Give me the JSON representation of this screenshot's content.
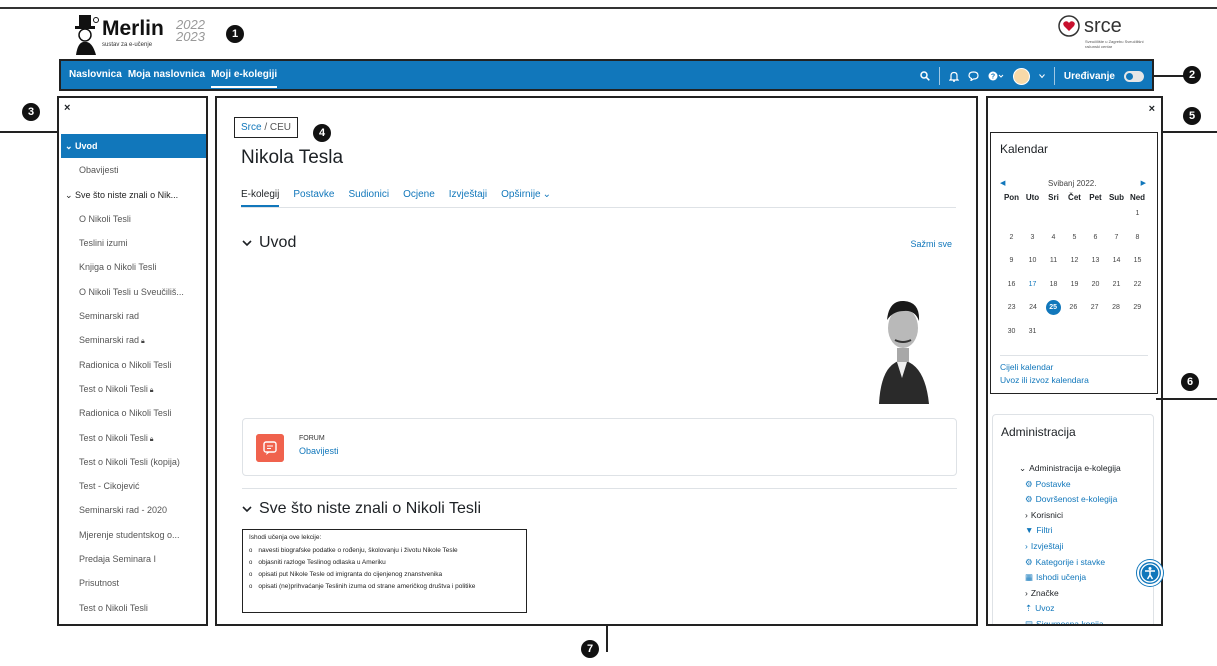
{
  "header": {
    "logo_text": "Merlin",
    "logo_sub": "sustav za e-učenje",
    "logo_year": "2022 2023",
    "partner_logo": "srce",
    "partner_sub": "Sveučilište u Zagrebu Sveučilišni računski centar"
  },
  "callouts": [
    "1",
    "2",
    "3",
    "4",
    "5",
    "6",
    "7"
  ],
  "navbar": {
    "links": [
      "Naslovnica",
      "Moja naslovnica",
      "Moji e-kolegiji"
    ],
    "active_index": 2,
    "icons": [
      "search-icon",
      "bell-icon",
      "chat-icon",
      "help-icon",
      "avatar-icon"
    ],
    "edit_label": "Uređivanje",
    "edit_on": false
  },
  "drawer": {
    "close": "×",
    "items": [
      {
        "label": "Uvod",
        "kind": "section",
        "active": true,
        "locked": false
      },
      {
        "label": "Obavijesti",
        "kind": "item",
        "active": false,
        "locked": false
      },
      {
        "label": "Sve što niste znali o Nik...",
        "kind": "section",
        "active": false,
        "locked": false
      },
      {
        "label": "O Nikoli Tesli",
        "kind": "item",
        "active": false,
        "locked": false
      },
      {
        "label": "Teslini izumi",
        "kind": "item",
        "active": false,
        "locked": false
      },
      {
        "label": "Knjiga o Nikoli Tesli",
        "kind": "item",
        "active": false,
        "locked": false
      },
      {
        "label": "O Nikoli Tesli u Sveučiliš...",
        "kind": "item",
        "active": false,
        "locked": false
      },
      {
        "label": "Seminarski rad",
        "kind": "item",
        "active": false,
        "locked": false
      },
      {
        "label": "Seminarski rad",
        "kind": "item",
        "active": false,
        "locked": true
      },
      {
        "label": "Radionica o Nikoli Tesli",
        "kind": "item",
        "active": false,
        "locked": false
      },
      {
        "label": "Test o Nikoli Tesli",
        "kind": "item",
        "active": false,
        "locked": true
      },
      {
        "label": "Radionica o Nikoli Tesli",
        "kind": "item",
        "active": false,
        "locked": false
      },
      {
        "label": "Test o Nikoli Tesli",
        "kind": "item",
        "active": false,
        "locked": true
      },
      {
        "label": "Test o Nikoli Tesli (kopija)",
        "kind": "item",
        "active": false,
        "locked": false
      },
      {
        "label": "Test - Cikojević",
        "kind": "item",
        "active": false,
        "locked": false
      },
      {
        "label": "Seminarski rad - 2020",
        "kind": "item",
        "active": false,
        "locked": false
      },
      {
        "label": "Mjerenje studentskog o...",
        "kind": "item",
        "active": false,
        "locked": false
      },
      {
        "label": "Predaja Seminara I",
        "kind": "item",
        "active": false,
        "locked": false
      },
      {
        "label": "Prisutnost",
        "kind": "item",
        "active": false,
        "locked": false
      },
      {
        "label": "Test o Nikoli Tesli",
        "kind": "item",
        "active": false,
        "locked": false
      }
    ]
  },
  "main": {
    "breadcrumb": {
      "link": "Srce",
      "sep": "/",
      "current": "CEU"
    },
    "title": "Nikola Tesla",
    "tabs": [
      "E-kolegij",
      "Postavke",
      "Sudionici",
      "Ocjene",
      "Izvještaji",
      "Opširnije"
    ],
    "active_tab": 0,
    "section1": {
      "title": "Uvod",
      "collapse_all": "Sažmi sve"
    },
    "forum": {
      "type": "FORUM",
      "name": "Obavijesti"
    },
    "section2": {
      "title": "Sve što niste znali o Nikoli Tesli"
    },
    "outcomes": {
      "intro": "Ishodi učenja ove lekcije:",
      "items": [
        "navesti biografske podatke o rođenju, školovanju i životu Nikole Tesle",
        "objasniti razloge Teslinog odlaska u Ameriku",
        "opisati put Nikole Tesle od imigranta do cijenjenog znanstvenika",
        "opisati (ne)prihvaćanje Teslinih izuma od strane američkog društva i politike"
      ]
    }
  },
  "right": {
    "close": "×",
    "calendar": {
      "title": "Kalendar",
      "month": "Svibanj 2022.",
      "weekdays": [
        "Pon",
        "Uto",
        "Sri",
        "Čet",
        "Pet",
        "Sub",
        "Ned"
      ],
      "weeks": [
        [
          "",
          "",
          "",
          "",
          "",
          "",
          "1"
        ],
        [
          "2",
          "3",
          "4",
          "5",
          "6",
          "7",
          "8"
        ],
        [
          "9",
          "10",
          "11",
          "12",
          "13",
          "14",
          "15"
        ],
        [
          "16",
          "17",
          "18",
          "19",
          "20",
          "21",
          "22"
        ],
        [
          "23",
          "24",
          "25",
          "26",
          "27",
          "28",
          "29"
        ],
        [
          "30",
          "31",
          "",
          "",
          "",
          "",
          ""
        ]
      ],
      "today": "25",
      "event_day": "17",
      "links": [
        "Cijeli kalendar",
        "Uvoz ili izvoz kalendara"
      ]
    },
    "admin": {
      "title": "Administracija",
      "tree": [
        {
          "label": "Administracija e-kolegija",
          "kind": "tx",
          "prefix": "⌄"
        },
        {
          "label": "Postavke",
          "kind": "lk",
          "prefix": "⚙"
        },
        {
          "label": "Dovršenost e-kolegija",
          "kind": "lk",
          "prefix": "⚙"
        },
        {
          "label": "Korisnici",
          "kind": "tx",
          "prefix": "›"
        },
        {
          "label": "Filtri",
          "kind": "lk",
          "prefix": "▼"
        },
        {
          "label": "Izvještaji",
          "kind": "lk",
          "prefix": "›"
        },
        {
          "label": "Kategorije i stavke",
          "kind": "lk",
          "prefix": "⚙"
        },
        {
          "label": "Ishodi učenja",
          "kind": "lk",
          "prefix": "▦"
        },
        {
          "label": "Značke",
          "kind": "tx",
          "prefix": "›"
        },
        {
          "label": "Uvoz",
          "kind": "lk",
          "prefix": "⇡"
        },
        {
          "label": "Sigurnosna kopija",
          "kind": "lk",
          "prefix": "▤"
        }
      ]
    }
  },
  "colors": {
    "primary": "#1177bb",
    "forum_icon": "#f0624d",
    "border": "#222222"
  }
}
